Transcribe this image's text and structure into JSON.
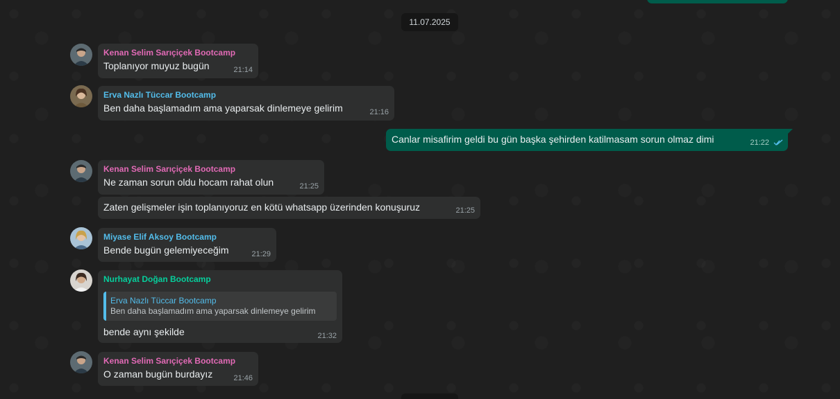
{
  "date_chip": "11.07.2025",
  "colors": {
    "kenan": "#e26ab6",
    "erva": "#53bdeb",
    "miyase": "#53bdeb",
    "nurhayat": "#06cf9c",
    "outgoing_bubble": "#005c4b",
    "incoming_bubble": "#2e2f2f"
  },
  "messages": [
    {
      "sender": "Kenan Selim Sarıçiçek Bootcamp",
      "text": "Toplanıyor muyuz bugün",
      "time": "21:14"
    },
    {
      "sender": "Erva Nazlı Tüccar Bootcamp",
      "text": "Ben daha başlamadım ama yaparsak dinlemeye gelirim",
      "time": "21:16"
    },
    {
      "sender": "",
      "text": "Canlar misafirim geldi bu gün başka şehirden katilmasam sorun olmaz dimi",
      "time": "21:22",
      "status_icon": "double-check-icon"
    },
    {
      "sender": "Kenan Selim Sarıçiçek Bootcamp",
      "text": "Ne zaman sorun oldu hocam rahat olun",
      "time": "21:25"
    },
    {
      "sender": "",
      "text": "Zaten gelişmeler işin toplanıyoruz en kötü whatsapp üzerinden konuşuruz",
      "time": "21:25"
    },
    {
      "sender": "Miyase Elif Aksoy Bootcamp",
      "text": "Bende bugün gelemiyeceğim",
      "time": "21:29"
    },
    {
      "sender": "Nurhayat Doğan Bootcamp",
      "text": "bende aynı şekilde",
      "time": "21:32",
      "quote": {
        "sender": "Erva Nazlı Tüccar Bootcamp",
        "text": "Ben daha başlamadım ama yaparsak dinlemeye gelirim"
      }
    },
    {
      "sender": "Kenan Selim Sarıçiçek Bootcamp",
      "text": "O zaman bugün burdayız",
      "time": "21:46"
    }
  ]
}
